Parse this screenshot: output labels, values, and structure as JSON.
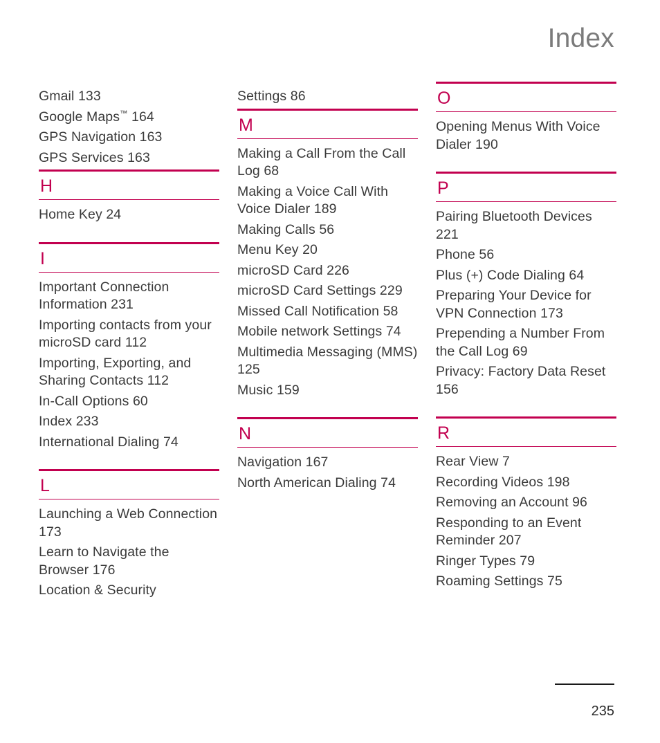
{
  "header": {
    "title": "Index"
  },
  "footer": {
    "page_number": "235"
  },
  "colors": {
    "accent": "#c2004f",
    "text": "#3a3a3a",
    "header_text": "#7b7b7b",
    "footer_rule": "#1a1a1a"
  },
  "columns": [
    {
      "groups": [
        {
          "type": "entries",
          "entries": [
            {
              "text": "Gmail 133"
            },
            {
              "text": "Google Maps",
              "sup": "™",
              "after": " 164"
            },
            {
              "text": "GPS Navigation 163"
            },
            {
              "text": "GPS Services 163"
            }
          ]
        },
        {
          "type": "letter",
          "letter": "H",
          "entries": [
            {
              "text": "Home Key 24"
            }
          ]
        },
        {
          "type": "letter",
          "letter": "I",
          "entries": [
            {
              "text": "Important Connection Information 231"
            },
            {
              "text": "Importing contacts from your microSD card 112"
            },
            {
              "text": "Importing, Exporting, and Sharing Contacts 112"
            },
            {
              "text": "In-Call Options 60"
            },
            {
              "text": "Index 233"
            },
            {
              "text": "International Dialing 74"
            }
          ]
        },
        {
          "type": "letter",
          "letter": "L",
          "entries": [
            {
              "text": "Launching a Web Connection 173"
            },
            {
              "text": "Learn to Navigate the Browser 176"
            },
            {
              "text": "Location & Security"
            }
          ]
        }
      ]
    },
    {
      "groups": [
        {
          "type": "entries",
          "entries": [
            {
              "text": "Settings 86"
            }
          ]
        },
        {
          "type": "letter",
          "letter": "M",
          "entries": [
            {
              "text": "Making a Call From the Call Log 68"
            },
            {
              "text": "Making a Voice Call With Voice Dialer 189"
            },
            {
              "text": "Making Calls 56"
            },
            {
              "text": "Menu Key 20"
            },
            {
              "text": "microSD Card 226"
            },
            {
              "text": "microSD Card Settings 229"
            },
            {
              "text": "Missed Call Notification 58"
            },
            {
              "text": "Mobile network Settings 74"
            },
            {
              "text": "Multimedia Messaging (MMS) 125"
            },
            {
              "text": "Music 159"
            }
          ]
        },
        {
          "type": "letter",
          "letter": "N",
          "entries": [
            {
              "text": "Navigation 167"
            },
            {
              "text": "North American Dialing 74"
            }
          ]
        }
      ]
    },
    {
      "groups": [
        {
          "type": "letter",
          "letter": "O",
          "entries": [
            {
              "text": "Opening Menus With Voice Dialer 190"
            }
          ]
        },
        {
          "type": "letter",
          "letter": "P",
          "entries": [
            {
              "text": "Pairing Bluetooth Devices 221"
            },
            {
              "text": "Phone 56"
            },
            {
              "text": "Plus (+) Code Dialing 64"
            },
            {
              "text": "Preparing Your Device for VPN Connection 173"
            },
            {
              "text": "Prepending a Number From the Call Log 69"
            },
            {
              "text": "Privacy: Factory Data Reset 156"
            }
          ]
        },
        {
          "type": "letter",
          "letter": "R",
          "entries": [
            {
              "text": "Rear View 7"
            },
            {
              "text": "Recording Videos 198"
            },
            {
              "text": "Removing an Account 96"
            },
            {
              "text": "Responding to an Event Reminder 207"
            },
            {
              "text": "Ringer Types 79"
            },
            {
              "text": "Roaming Settings 75"
            }
          ]
        }
      ]
    }
  ]
}
